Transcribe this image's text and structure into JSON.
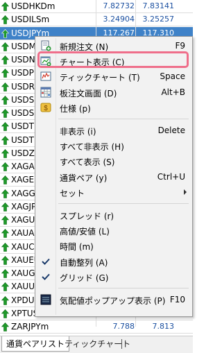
{
  "symbols": [
    {
      "name": "USDHKDm",
      "bid": "7.82732",
      "ask": "7.83141",
      "selected": false
    },
    {
      "name": "USDILSm",
      "bid": "3.24904",
      "ask": "3.25257",
      "selected": false
    },
    {
      "name": "USDJPYm",
      "bid": "117.267",
      "ask": "117.310",
      "selected": true
    },
    {
      "name": "USDM",
      "bid": "",
      "ask": "",
      "selected": false
    },
    {
      "name": "USDNO",
      "bid": "",
      "ask": "",
      "selected": false
    },
    {
      "name": "USDPL",
      "bid": "",
      "ask": "",
      "selected": false
    },
    {
      "name": "USDRU",
      "bid": "",
      "ask": "",
      "selected": false
    },
    {
      "name": "USDSE",
      "bid": "",
      "ask": "",
      "selected": false
    },
    {
      "name": "USDSG",
      "bid": "",
      "ask": "",
      "selected": false
    },
    {
      "name": "USDTH",
      "bid": "",
      "ask": "",
      "selected": false
    },
    {
      "name": "USDTR",
      "bid": "",
      "ask": "",
      "selected": false
    },
    {
      "name": "USDZA",
      "bid": "",
      "ask": "",
      "selected": false
    },
    {
      "name": "XAGAU",
      "bid": "",
      "ask": "",
      "selected": false
    },
    {
      "name": "XAGEU",
      "bid": "",
      "ask": "",
      "selected": false
    },
    {
      "name": "XAGGB",
      "bid": "",
      "ask": "",
      "selected": false
    },
    {
      "name": "XAGJP",
      "bid": "",
      "ask": "",
      "selected": false
    },
    {
      "name": "XAGUS",
      "bid": "",
      "ask": "",
      "selected": false
    },
    {
      "name": "XAUAU",
      "bid": "",
      "ask": "",
      "selected": false
    },
    {
      "name": "XAUCH",
      "bid": "",
      "ask": "",
      "selected": false
    },
    {
      "name": "XAUEU",
      "bid": "",
      "ask": "",
      "selected": false
    },
    {
      "name": "XAUGB",
      "bid": "",
      "ask": "",
      "selected": false
    },
    {
      "name": "XAUUS",
      "bid": "",
      "ask": "",
      "selected": false
    },
    {
      "name": "XPDUS",
      "bid": "",
      "ask": "",
      "selected": false
    },
    {
      "name": "XPTUS",
      "bid": "",
      "ask": "",
      "selected": false
    },
    {
      "name": "ZARJPYm",
      "bid": "7.788",
      "ask": "7.813",
      "selected": false
    }
  ],
  "tabs": {
    "active": "通貨ペアリスト",
    "inactive": "ティックチャート"
  },
  "menu": [
    {
      "type": "item",
      "label": "新規注文 (N)",
      "shortcut": "F9",
      "icon": "new-order-icon"
    },
    {
      "type": "item",
      "label": "チャート表示 (C)",
      "shortcut": "",
      "icon": "chart-window-icon",
      "highlighted": true
    },
    {
      "type": "item",
      "label": "ティックチャート (T)",
      "shortcut": "Space",
      "icon": "tick-chart-icon"
    },
    {
      "type": "item",
      "label": "板注文画面 (D)",
      "shortcut": "Alt+B",
      "icon": "depth-grid-icon"
    },
    {
      "type": "item",
      "label": "仕様 (p)",
      "shortcut": "",
      "icon": "specification-icon"
    },
    {
      "type": "sep"
    },
    {
      "type": "item",
      "label": "非表示 (i)",
      "shortcut": "Delete"
    },
    {
      "type": "item",
      "label": "すべて非表示 (H)",
      "shortcut": ""
    },
    {
      "type": "item",
      "label": "すべて表示 (S)",
      "shortcut": ""
    },
    {
      "type": "item",
      "label": "通貨ペア (y)",
      "shortcut": "Ctrl+U"
    },
    {
      "type": "item",
      "label": "セット",
      "shortcut": "",
      "submenu": true
    },
    {
      "type": "sep"
    },
    {
      "type": "item",
      "label": "スプレッド (r)",
      "shortcut": ""
    },
    {
      "type": "item",
      "label": "高値/安値 (L)",
      "shortcut": ""
    },
    {
      "type": "item",
      "label": "時間 (m)",
      "shortcut": ""
    },
    {
      "type": "item",
      "label": "自動整列 (A)",
      "shortcut": "",
      "checked": true
    },
    {
      "type": "item",
      "label": "グリッド (G)",
      "shortcut": "",
      "checked": true
    },
    {
      "type": "sep"
    },
    {
      "type": "item",
      "label": "気配値ポップアップ表示 (P)",
      "shortcut": "F10",
      "icon": "popup-quotes-icon"
    }
  ],
  "colors": {
    "selection": "#3f82c8",
    "highlight_border": "#ef6e8a",
    "up_arrow": "#1f9a2a",
    "price_text": "#1a4fa0"
  }
}
